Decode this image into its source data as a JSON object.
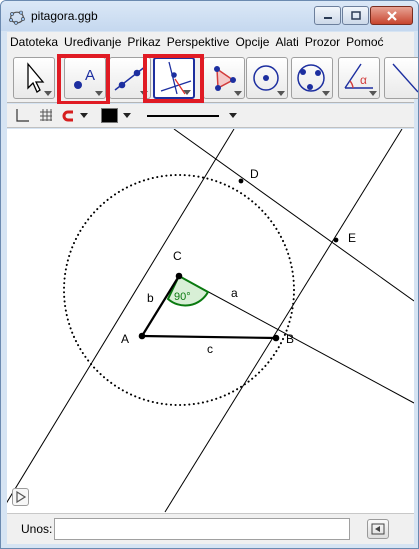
{
  "window": {
    "title": "pitagora.ggb"
  },
  "menu": [
    "Datoteka",
    "Uređivanje",
    "Prikaz",
    "Perspektive",
    "Opcije",
    "Alati",
    "Prozor",
    "Pomoć"
  ],
  "toolbar": {
    "tools": [
      "move-tool",
      "point-tool",
      "line-tool",
      "perpendicular-line-tool",
      "polygon-tool",
      "circle-tool",
      "conic-tool",
      "angle-tool",
      "reflect-tool"
    ],
    "highlighted": [
      "point-tool",
      "perpendicular-line-tool"
    ],
    "selected": "perpendicular-line-tool",
    "point_tool_letter": "A",
    "angle_tool_letter": "α"
  },
  "stylebar": {
    "color_swatch": "#000000"
  },
  "construction": {
    "points": {
      "A": "A",
      "B": "B",
      "C": "C",
      "D": "D",
      "E": "E"
    },
    "segments": {
      "a": "a",
      "b": "b",
      "c": "c"
    },
    "angle_label": "90°"
  },
  "inputbar": {
    "label": "Unos:",
    "value": ""
  },
  "colors": {
    "highlight_box": "#e01b24",
    "selected_tool_border": "#1e2f9e",
    "angle": "#0a7a10",
    "point": "#000000"
  }
}
